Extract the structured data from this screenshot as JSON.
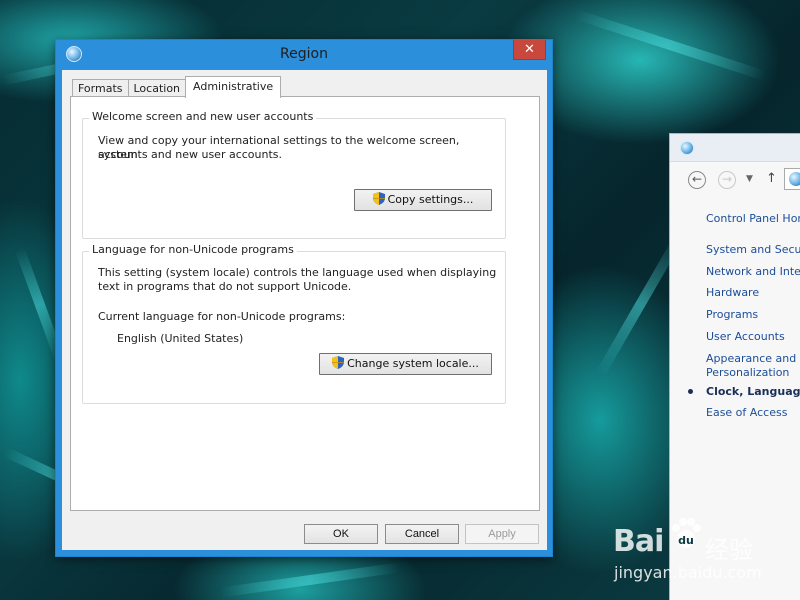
{
  "dialog": {
    "title": "Region",
    "close_glyph": "✕",
    "tabs": [
      {
        "label": "Formats",
        "active": false
      },
      {
        "label": "Location",
        "active": false
      },
      {
        "label": "Administrative",
        "active": true
      }
    ],
    "welcome_group": {
      "title": "Welcome screen and new user accounts",
      "description_line1": "View and copy your international settings to the welcome screen, system",
      "description_line2": "accounts and new user accounts.",
      "button_label": "Copy settings..."
    },
    "locale_group": {
      "title": "Language for non-Unicode programs",
      "description_line1": "This setting (system locale) controls the language used when displaying",
      "description_line2": "text in programs that do not support Unicode.",
      "current_label": "Current language for non-Unicode programs:",
      "current_value": "English (United States)",
      "button_label": "Change system locale..."
    },
    "buttons": {
      "ok": "OK",
      "cancel": "Cancel",
      "apply": "Apply"
    },
    "icons": {
      "title": "region-globe-icon",
      "shield": "uac-shield-icon"
    }
  },
  "control_panel": {
    "nav": {
      "back_glyph": "←",
      "forward_glyph": "→",
      "dropdown_glyph": "▼",
      "up_glyph": "↑"
    },
    "links": [
      {
        "label": "Control Panel Hor",
        "current": false
      },
      {
        "label": "System and Secur",
        "current": false
      },
      {
        "label": "Network and Inter",
        "current": false
      },
      {
        "label": "Hardware",
        "current": false
      },
      {
        "label": "Programs",
        "current": false
      },
      {
        "label": "User Accounts",
        "current": false
      },
      {
        "label": "Appearance and",
        "current": false
      },
      {
        "label": "Personalization",
        "current": false
      },
      {
        "label": "Clock, Language, a",
        "current": true
      },
      {
        "label": "Ease of Access",
        "current": false
      }
    ]
  },
  "watermark": {
    "logo_text": "Bai",
    "logo_suffix": "经验",
    "url": "jingyan.baidu.com"
  },
  "colors": {
    "titlebar": "#2b8fdc",
    "close_button": "#c9483e",
    "link": "#1c4d99",
    "desktop": "#0a3b42"
  }
}
